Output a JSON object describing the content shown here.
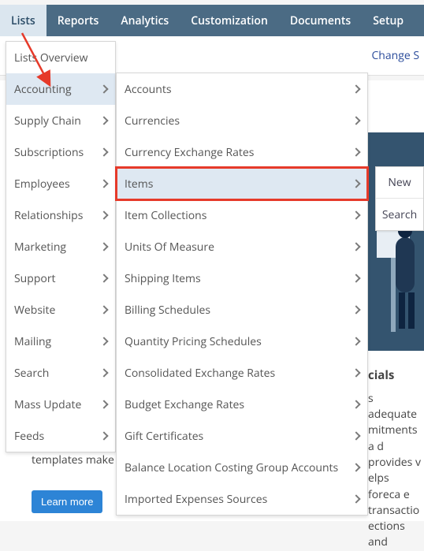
{
  "topnav": {
    "items": [
      "Lists",
      "Reports",
      "Analytics",
      "Customization",
      "Documents",
      "Setup"
    ],
    "active_index": 0
  },
  "header": {
    "change_label": "Change S"
  },
  "menu1": {
    "overview": "Lists Overview",
    "items": [
      "Accounting",
      "Supply Chain",
      "Subscriptions",
      "Employees",
      "Relationships",
      "Marketing",
      "Support",
      "Website",
      "Mailing",
      "Search",
      "Mass Update",
      "Feeds"
    ],
    "highlight_index": 0
  },
  "menu2": {
    "items": [
      "Accounts",
      "Currencies",
      "Currency Exchange Rates",
      "Items",
      "Item Collections",
      "Units Of Measure",
      "Shipping Items",
      "Billing Schedules",
      "Quantity Pricing Schedules",
      "Consolidated Exchange Rates",
      "Budget Exchange Rates",
      "Gift Certificates",
      "Balance Location Costing Group Accounts",
      "Imported Expenses Sources"
    ],
    "highlight_index": 3
  },
  "side_panel": {
    "new": "New",
    "search": "Search"
  },
  "fin_card": {
    "title": "cials",
    "body": "s adequate mitments a d provides v elps foreca e transactio ections and"
  },
  "tpl_text": "templates make it invoices to the sp",
  "learn_more": "Learn more"
}
